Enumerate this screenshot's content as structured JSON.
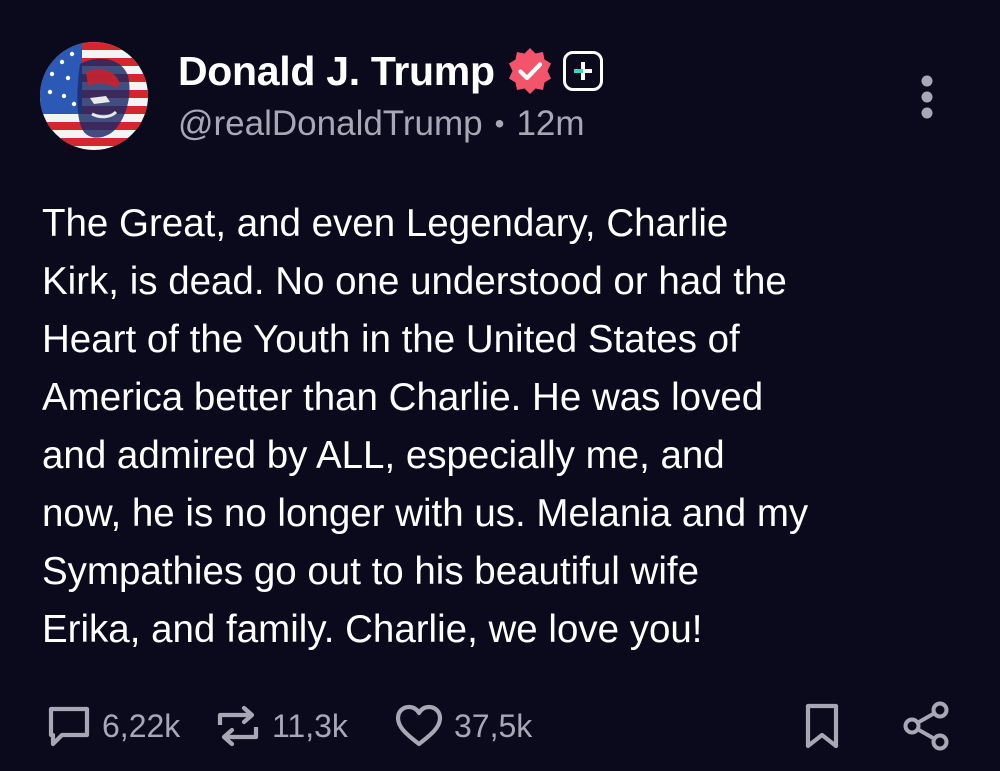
{
  "post": {
    "author": {
      "display_name": "Donald J. Trump",
      "handle": "@realDonaldTrump",
      "verified": true
    },
    "timestamp": "12m",
    "separator": "•",
    "text": "The Great, and even Legendary, Charlie\nKirk, is dead. No one understood or had the\nHeart of the Youth in the United States of\nAmerica better than Charlie. He was loved\nand admired by ALL, especially me, and\nnow, he is no longer with us. Melania and my\nSympathies go out to his beautiful wife\nErika, and family. Charlie, we love you!",
    "stats": {
      "replies": "6,22k",
      "reposts": "11,3k",
      "likes": "37,5k"
    }
  },
  "colors": {
    "background": "#0b0a1d",
    "text_primary": "#ffffff",
    "text_secondary": "#a8a7b6",
    "verified_badge": "#f2556b",
    "plus_badge_accent": "#2fd8c5"
  },
  "icons": {
    "avatar": "flag-portrait-avatar",
    "verified": "verified-badge-icon",
    "plus": "plus-badge-icon",
    "more": "more-vertical-icon",
    "reply": "reply-icon",
    "repost": "repost-icon",
    "like": "heart-icon",
    "bookmark": "bookmark-icon",
    "share": "share-icon"
  }
}
